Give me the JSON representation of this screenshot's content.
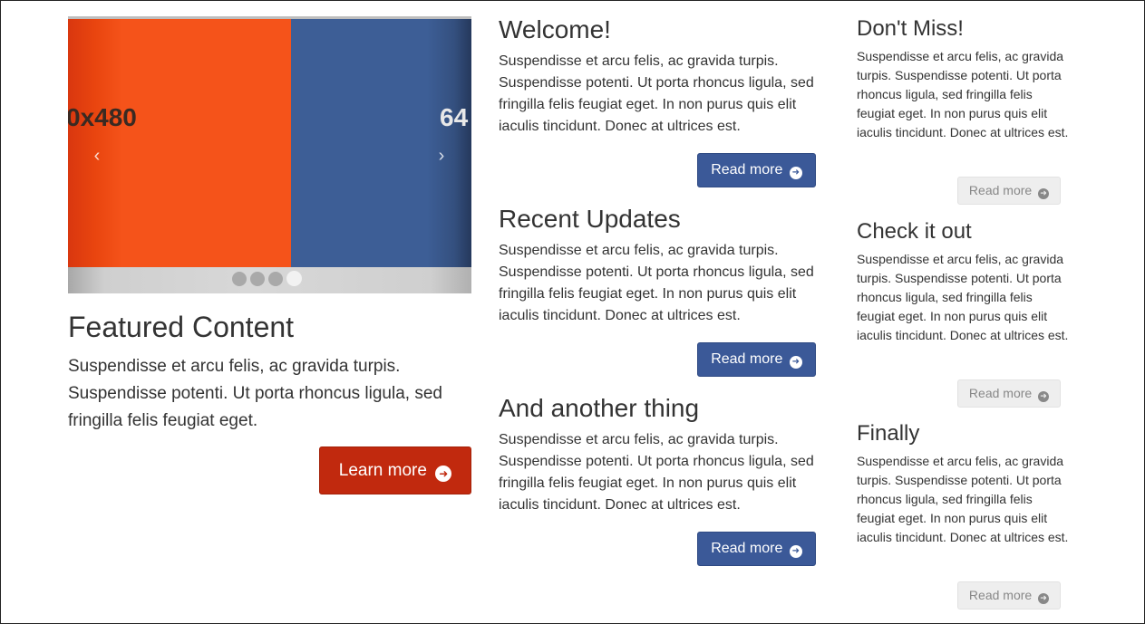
{
  "carousel": {
    "slides": [
      {
        "label": "0x480",
        "color": "#f5531a"
      },
      {
        "label": "64",
        "color": "#3d5e96"
      }
    ],
    "prev_icon": "chevron-left-icon",
    "next_icon": "chevron-right-icon",
    "prev_glyph": "‹",
    "next_glyph": "›",
    "indicator_count": 4,
    "active_indicator": 4
  },
  "featured": {
    "title": "Featured Content",
    "text": "Suspendisse et arcu felis, ac gravida turpis. Suspendisse potenti. Ut porta rhoncus ligula, sed fringilla felis feugiat eget.",
    "button_label": "Learn more",
    "button_color": "#c1290e"
  },
  "middle": {
    "button_color": "#3b5998",
    "blocks": [
      {
        "title": "Welcome!",
        "text": "Suspendisse et arcu felis, ac gravida turpis. Suspendisse potenti. Ut porta rhoncus ligula, sed fringilla felis feugiat eget. In non purus quis elit iaculis tincidunt. Donec at ultrices est.",
        "button_label": "Read more"
      },
      {
        "title": "Recent Updates",
        "text": "Suspendisse et arcu felis, ac gravida turpis. Suspendisse potenti. Ut porta rhoncus ligula, sed fringilla felis feugiat eget. In non purus quis elit iaculis tincidunt. Donec at ultrices est.",
        "button_label": "Read more"
      },
      {
        "title": "And another thing",
        "text": "Suspendisse et arcu felis, ac gravida turpis. Suspendisse potenti. Ut porta rhoncus ligula, sed fringilla felis feugiat eget. In non purus quis elit iaculis tincidunt. Donec at ultrices est.",
        "button_label": "Read more"
      }
    ]
  },
  "sidebar": {
    "blocks": [
      {
        "title": "Don't Miss!",
        "text": "Suspendisse et arcu felis, ac gravida turpis. Suspendisse potenti. Ut porta rhoncus ligula, sed fringilla felis feugiat eget. In non purus quis elit iaculis tincidunt. Donec at ultrices est.",
        "button_label": "Read more"
      },
      {
        "title": "Check it out",
        "text": "Suspendisse et arcu felis, ac gravida turpis. Suspendisse potenti. Ut porta rhoncus ligula, sed fringilla felis feugiat eget. In non purus quis elit iaculis tincidunt. Donec at ultrices est.",
        "button_label": "Read more"
      },
      {
        "title": "Finally",
        "text": "Suspendisse et arcu felis, ac gravida turpis. Suspendisse potenti. Ut porta rhoncus ligula, sed fringilla felis feugiat eget. In non purus quis elit iaculis tincidunt. Donec at ultrices est.",
        "button_label": "Read more"
      }
    ]
  },
  "icons": {
    "button_arrow": "arrow-circle-right-icon",
    "arrow_glyph": "➜"
  }
}
